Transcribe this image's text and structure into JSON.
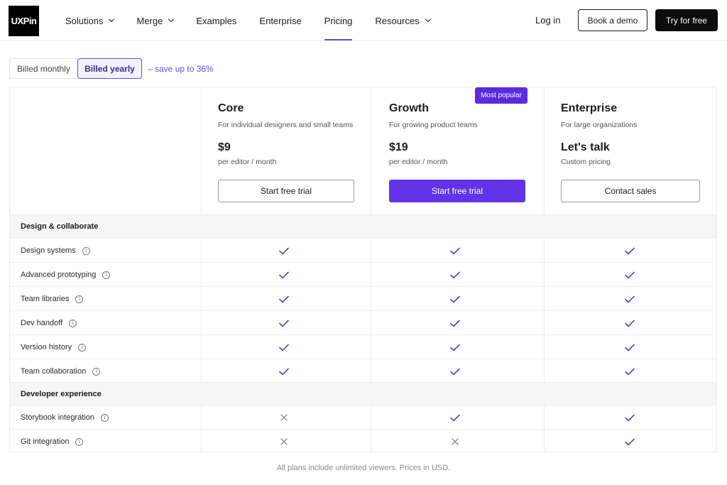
{
  "header": {
    "logo_text": "UXPin",
    "nav": [
      {
        "label": "Solutions",
        "dropdown": true,
        "active": false
      },
      {
        "label": "Merge",
        "dropdown": true,
        "active": false
      },
      {
        "label": "Examples",
        "dropdown": false,
        "active": false
      },
      {
        "label": "Enterprise",
        "dropdown": false,
        "active": false
      },
      {
        "label": "Pricing",
        "dropdown": false,
        "active": true
      },
      {
        "label": "Resources",
        "dropdown": true,
        "active": false
      }
    ],
    "login_label": "Log in",
    "demo_label": "Book a demo",
    "try_label": "Try for free"
  },
  "billing": {
    "monthly_label": "Billed monthly",
    "yearly_label": "Billed yearly",
    "selected": "yearly",
    "save_note": "– save up to 36%"
  },
  "plans": [
    {
      "name": "Core",
      "description": "For individual designers and small teams",
      "price": "$9",
      "price_note": "per editor / month",
      "cta": "Start free trial",
      "cta_style": "outline"
    },
    {
      "name": "Growth",
      "description": "For growing product teams",
      "price": "$19",
      "price_note": "per editor / month",
      "cta": "Start free trial",
      "cta_style": "primary",
      "badge": "Most popular"
    },
    {
      "name": "Enterprise",
      "description": "For large organizations",
      "price": "Let's talk",
      "price_note": "Custom pricing",
      "cta": "Contact sales",
      "cta_style": "outline"
    }
  ],
  "sections": [
    {
      "title": "Design & collaborate",
      "features": [
        {
          "label": "Design systems",
          "values": [
            "check",
            "check",
            "check"
          ]
        },
        {
          "label": "Advanced prototyping",
          "values": [
            "check",
            "check",
            "check"
          ]
        },
        {
          "label": "Team libraries",
          "values": [
            "check",
            "check",
            "check"
          ]
        },
        {
          "label": "Dev handoff",
          "values": [
            "check",
            "check",
            "check"
          ]
        },
        {
          "label": "Version history",
          "values": [
            "check",
            "check",
            "check"
          ]
        },
        {
          "label": "Team collaboration",
          "values": [
            "check",
            "check",
            "check"
          ]
        }
      ]
    },
    {
      "title": "Developer experience",
      "features": [
        {
          "label": "Storybook integration",
          "values": [
            "cross",
            "check",
            "check"
          ]
        },
        {
          "label": "Git integration",
          "values": [
            "cross",
            "cross",
            "check"
          ]
        }
      ]
    }
  ],
  "footnote": "All plans include unlimited viewers. Prices in USD.",
  "colors": {
    "accent": "#6134ea",
    "check": "#5a3fcf",
    "cross": "#8a8a8a"
  }
}
